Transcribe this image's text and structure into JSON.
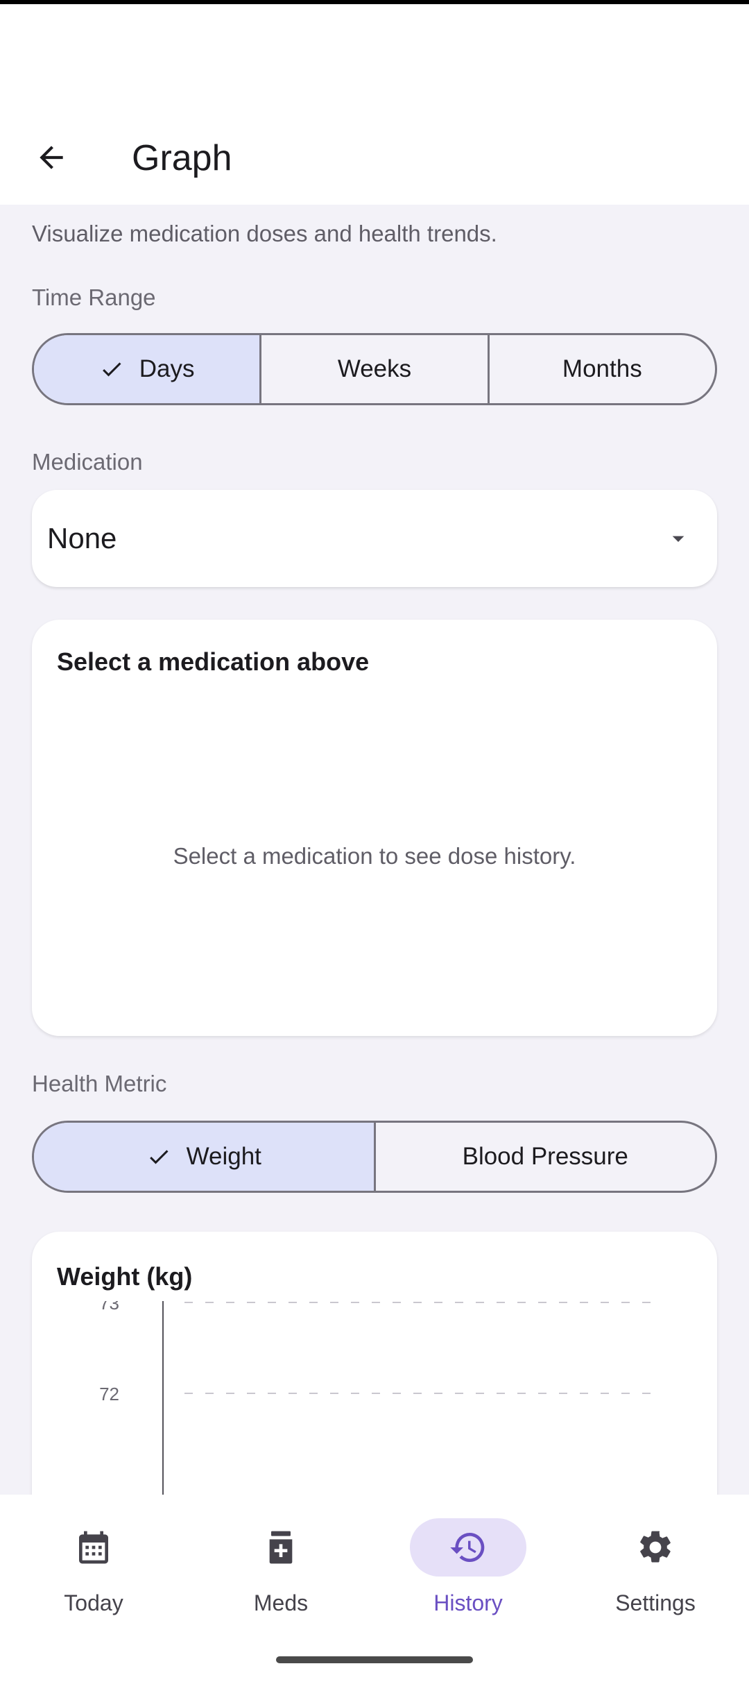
{
  "header": {
    "title": "Graph"
  },
  "subtitle": "Visualize medication doses and health trends.",
  "time_range": {
    "label": "Time Range",
    "options": [
      "Days",
      "Weeks",
      "Months"
    ],
    "selected": "Days"
  },
  "medication": {
    "label": "Medication",
    "selected": "None"
  },
  "dose_card": {
    "title": "Select a medication above",
    "empty_message": "Select a medication to see dose history."
  },
  "health_metric": {
    "label": "Health Metric",
    "options": [
      "Weight",
      "Blood Pressure"
    ],
    "selected": "Weight"
  },
  "chart_data": {
    "type": "line",
    "title": "Weight (kg)",
    "xlabel": "",
    "ylabel": "",
    "y_ticks": [
      "73",
      "72"
    ],
    "ylim": [
      71,
      73
    ],
    "grid": true,
    "series": []
  },
  "bottom_nav": {
    "items": [
      {
        "label": "Today",
        "icon": "calendar-icon"
      },
      {
        "label": "Meds",
        "icon": "medication-icon"
      },
      {
        "label": "History",
        "icon": "history-icon"
      },
      {
        "label": "Settings",
        "icon": "gear-icon"
      }
    ],
    "active": "History"
  },
  "colors": {
    "accent": "#6a4fc2",
    "segment_selected": "#dde1f9",
    "nav_pill": "#e6e0f8"
  }
}
